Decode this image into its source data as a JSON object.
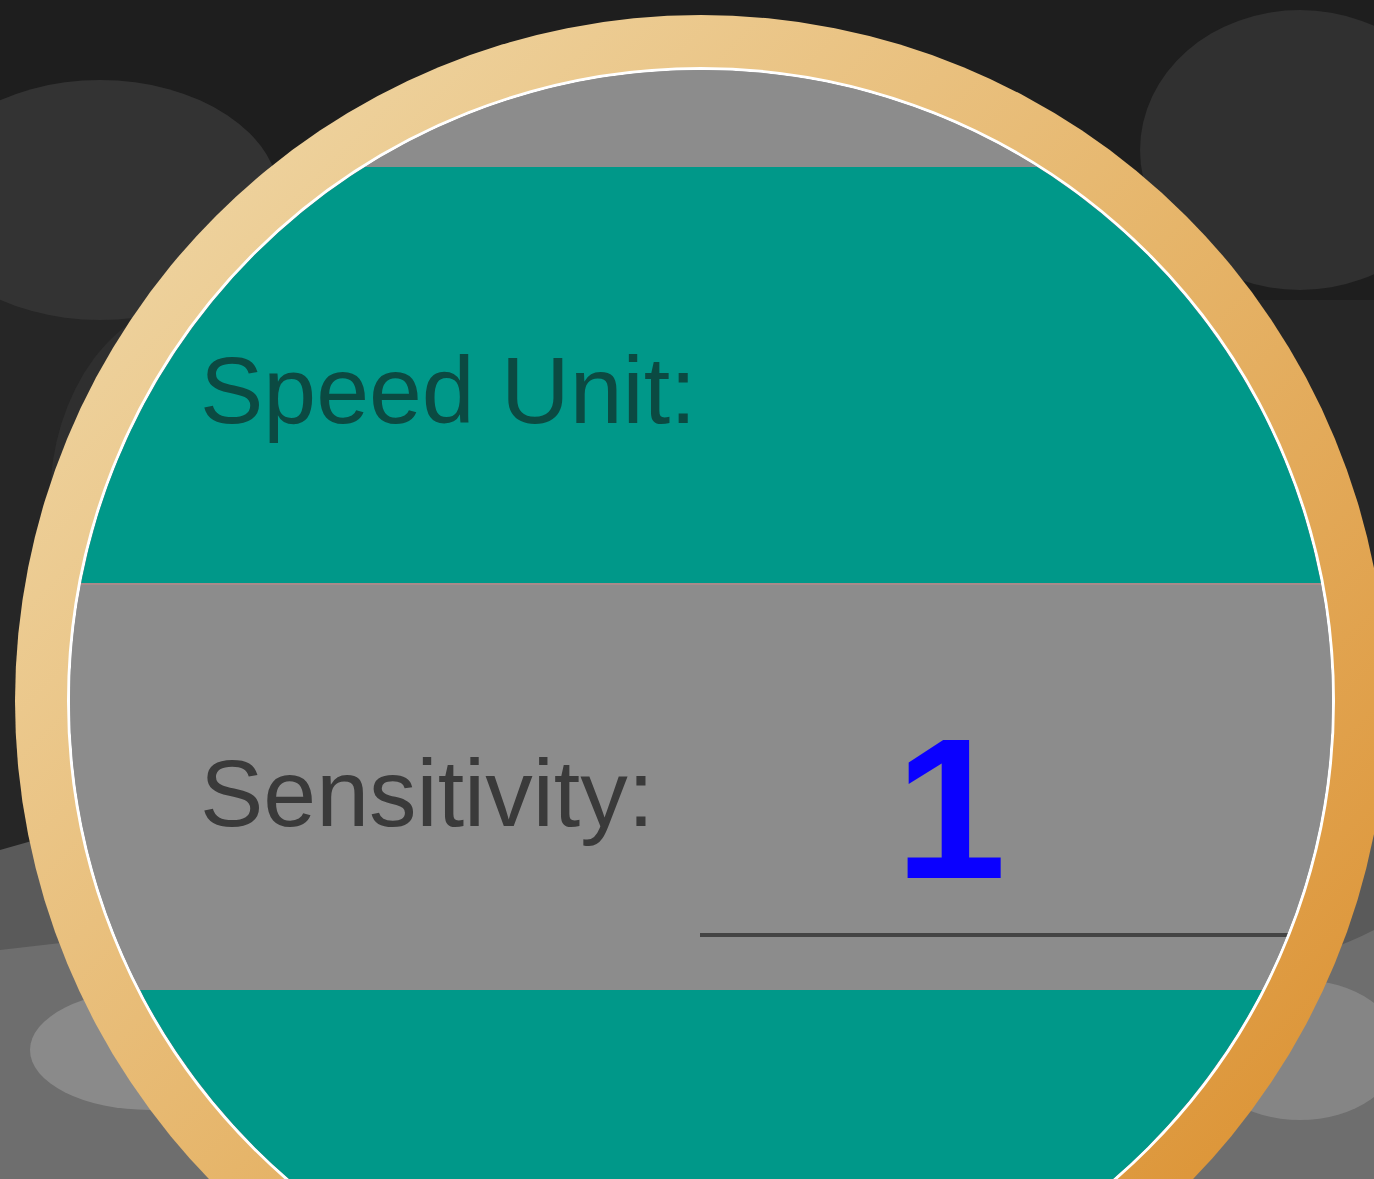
{
  "rows": [
    {
      "label": "Speed Unit:",
      "highlighted": true
    },
    {
      "label": "Sensitivity:",
      "highlighted": false,
      "value": "1"
    }
  ]
}
